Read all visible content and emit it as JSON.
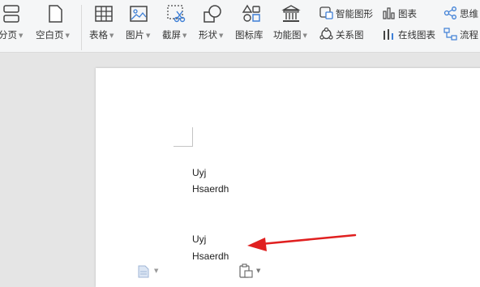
{
  "toolbar": {
    "items": {
      "page_break": "分页",
      "blank_page": "空白页",
      "table": "表格",
      "picture": "图片",
      "screenshot": "截屏",
      "shape": "形状",
      "icon_library": "图标库",
      "function_chart": "功能图",
      "smart_graphic": "智能图形",
      "chart": "图表",
      "mind_map": "思维",
      "relation_chart": "关系图",
      "online_chart": "在线图表",
      "flowchart": "流程"
    }
  },
  "document": {
    "lines": [
      "Uyj",
      "Hsaerdh",
      "Uyj",
      "Hsaerdh"
    ]
  },
  "colors": {
    "icon_blue": "#3e7fd6",
    "arrow_red": "#e02020",
    "ribbon_bg": "#f5f6f7",
    "canvas_bg": "#e5e5e5"
  }
}
